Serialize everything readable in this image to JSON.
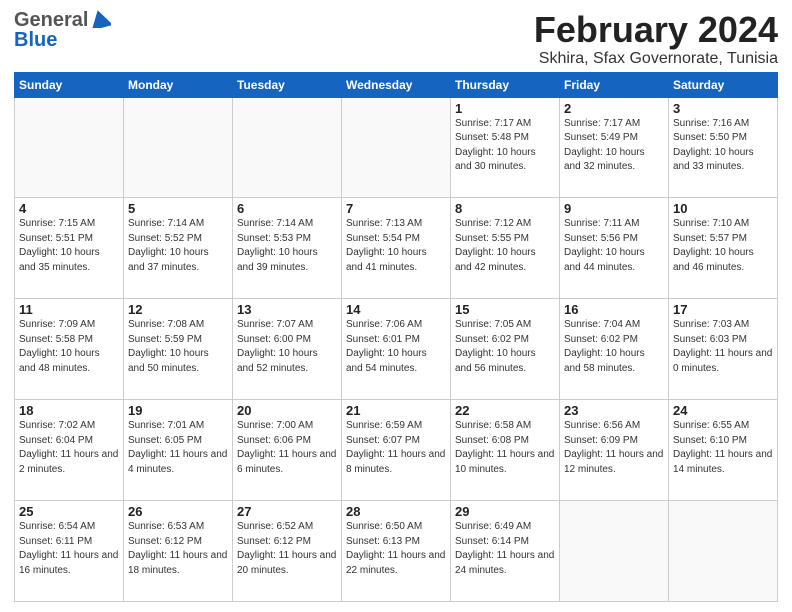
{
  "header": {
    "logo_general": "General",
    "logo_blue": "Blue",
    "title": "February 2024",
    "subtitle": "Skhira, Sfax Governorate, Tunisia"
  },
  "days_of_week": [
    "Sunday",
    "Monday",
    "Tuesday",
    "Wednesday",
    "Thursday",
    "Friday",
    "Saturday"
  ],
  "weeks": [
    [
      {
        "day": "",
        "info": ""
      },
      {
        "day": "",
        "info": ""
      },
      {
        "day": "",
        "info": ""
      },
      {
        "day": "",
        "info": ""
      },
      {
        "day": "1",
        "info": "Sunrise: 7:17 AM\nSunset: 5:48 PM\nDaylight: 10 hours\nand 30 minutes."
      },
      {
        "day": "2",
        "info": "Sunrise: 7:17 AM\nSunset: 5:49 PM\nDaylight: 10 hours\nand 32 minutes."
      },
      {
        "day": "3",
        "info": "Sunrise: 7:16 AM\nSunset: 5:50 PM\nDaylight: 10 hours\nand 33 minutes."
      }
    ],
    [
      {
        "day": "4",
        "info": "Sunrise: 7:15 AM\nSunset: 5:51 PM\nDaylight: 10 hours\nand 35 minutes."
      },
      {
        "day": "5",
        "info": "Sunrise: 7:14 AM\nSunset: 5:52 PM\nDaylight: 10 hours\nand 37 minutes."
      },
      {
        "day": "6",
        "info": "Sunrise: 7:14 AM\nSunset: 5:53 PM\nDaylight: 10 hours\nand 39 minutes."
      },
      {
        "day": "7",
        "info": "Sunrise: 7:13 AM\nSunset: 5:54 PM\nDaylight: 10 hours\nand 41 minutes."
      },
      {
        "day": "8",
        "info": "Sunrise: 7:12 AM\nSunset: 5:55 PM\nDaylight: 10 hours\nand 42 minutes."
      },
      {
        "day": "9",
        "info": "Sunrise: 7:11 AM\nSunset: 5:56 PM\nDaylight: 10 hours\nand 44 minutes."
      },
      {
        "day": "10",
        "info": "Sunrise: 7:10 AM\nSunset: 5:57 PM\nDaylight: 10 hours\nand 46 minutes."
      }
    ],
    [
      {
        "day": "11",
        "info": "Sunrise: 7:09 AM\nSunset: 5:58 PM\nDaylight: 10 hours\nand 48 minutes."
      },
      {
        "day": "12",
        "info": "Sunrise: 7:08 AM\nSunset: 5:59 PM\nDaylight: 10 hours\nand 50 minutes."
      },
      {
        "day": "13",
        "info": "Sunrise: 7:07 AM\nSunset: 6:00 PM\nDaylight: 10 hours\nand 52 minutes."
      },
      {
        "day": "14",
        "info": "Sunrise: 7:06 AM\nSunset: 6:01 PM\nDaylight: 10 hours\nand 54 minutes."
      },
      {
        "day": "15",
        "info": "Sunrise: 7:05 AM\nSunset: 6:02 PM\nDaylight: 10 hours\nand 56 minutes."
      },
      {
        "day": "16",
        "info": "Sunrise: 7:04 AM\nSunset: 6:02 PM\nDaylight: 10 hours\nand 58 minutes."
      },
      {
        "day": "17",
        "info": "Sunrise: 7:03 AM\nSunset: 6:03 PM\nDaylight: 11 hours\nand 0 minutes."
      }
    ],
    [
      {
        "day": "18",
        "info": "Sunrise: 7:02 AM\nSunset: 6:04 PM\nDaylight: 11 hours\nand 2 minutes."
      },
      {
        "day": "19",
        "info": "Sunrise: 7:01 AM\nSunset: 6:05 PM\nDaylight: 11 hours\nand 4 minutes."
      },
      {
        "day": "20",
        "info": "Sunrise: 7:00 AM\nSunset: 6:06 PM\nDaylight: 11 hours\nand 6 minutes."
      },
      {
        "day": "21",
        "info": "Sunrise: 6:59 AM\nSunset: 6:07 PM\nDaylight: 11 hours\nand 8 minutes."
      },
      {
        "day": "22",
        "info": "Sunrise: 6:58 AM\nSunset: 6:08 PM\nDaylight: 11 hours\nand 10 minutes."
      },
      {
        "day": "23",
        "info": "Sunrise: 6:56 AM\nSunset: 6:09 PM\nDaylight: 11 hours\nand 12 minutes."
      },
      {
        "day": "24",
        "info": "Sunrise: 6:55 AM\nSunset: 6:10 PM\nDaylight: 11 hours\nand 14 minutes."
      }
    ],
    [
      {
        "day": "25",
        "info": "Sunrise: 6:54 AM\nSunset: 6:11 PM\nDaylight: 11 hours\nand 16 minutes."
      },
      {
        "day": "26",
        "info": "Sunrise: 6:53 AM\nSunset: 6:12 PM\nDaylight: 11 hours\nand 18 minutes."
      },
      {
        "day": "27",
        "info": "Sunrise: 6:52 AM\nSunset: 6:12 PM\nDaylight: 11 hours\nand 20 minutes."
      },
      {
        "day": "28",
        "info": "Sunrise: 6:50 AM\nSunset: 6:13 PM\nDaylight: 11 hours\nand 22 minutes."
      },
      {
        "day": "29",
        "info": "Sunrise: 6:49 AM\nSunset: 6:14 PM\nDaylight: 11 hours\nand 24 minutes."
      },
      {
        "day": "",
        "info": ""
      },
      {
        "day": "",
        "info": ""
      }
    ]
  ]
}
